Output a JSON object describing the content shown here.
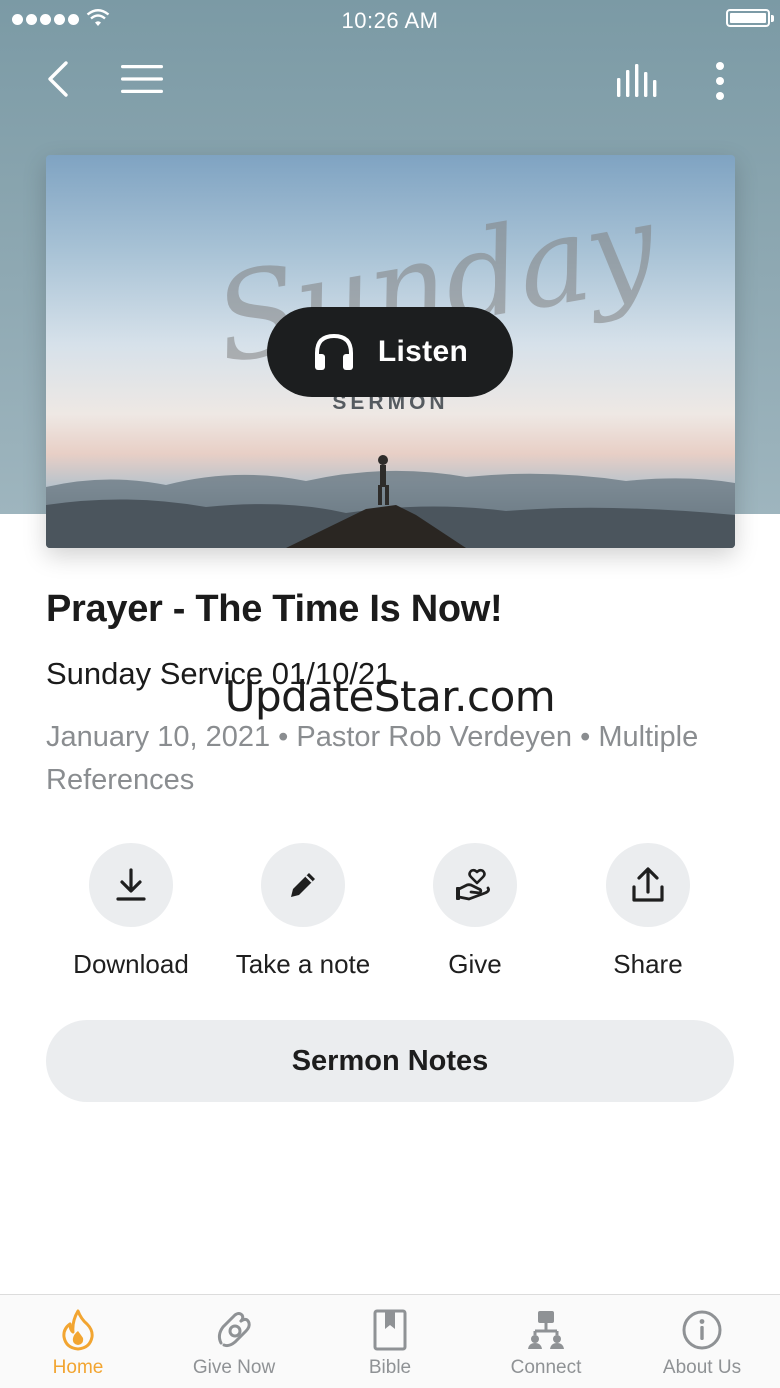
{
  "status_bar": {
    "time": "10:26 AM"
  },
  "nav": {
    "back": "back-icon",
    "menu": "hamburger-icon",
    "stats": "audio-bars-icon",
    "more": "vertical-dots-icon"
  },
  "hero": {
    "script_word": "Sunday",
    "label": "SERMON",
    "listen_label": "Listen"
  },
  "sermon": {
    "title": "Prayer - The Time Is Now!",
    "subtitle": "Sunday Service 01/10/21",
    "meta": "January 10, 2021 • Pastor Rob Verdeyen • Multiple References"
  },
  "watermark": "UpdateStar.com",
  "actions": [
    {
      "label": "Download",
      "icon": "download-icon"
    },
    {
      "label": "Take a note",
      "icon": "pencil-icon"
    },
    {
      "label": "Give",
      "icon": "give-hand-heart-icon"
    },
    {
      "label": "Share",
      "icon": "share-icon"
    }
  ],
  "notes_button": "Sermon Notes",
  "tabs": [
    {
      "label": "Home",
      "icon": "flame-icon",
      "active": true
    },
    {
      "label": "Give Now",
      "icon": "give-now-icon",
      "active": false
    },
    {
      "label": "Bible",
      "icon": "bible-icon",
      "active": false
    },
    {
      "label": "Connect",
      "icon": "connect-icon",
      "active": false
    },
    {
      "label": "About Us",
      "icon": "info-icon",
      "active": false
    }
  ],
  "colors": {
    "accent": "#f2a531",
    "header": "#8fa9b3",
    "button_dark": "#1c1e1f",
    "chip": "#ebedef",
    "muted_text": "#8a8d90"
  }
}
